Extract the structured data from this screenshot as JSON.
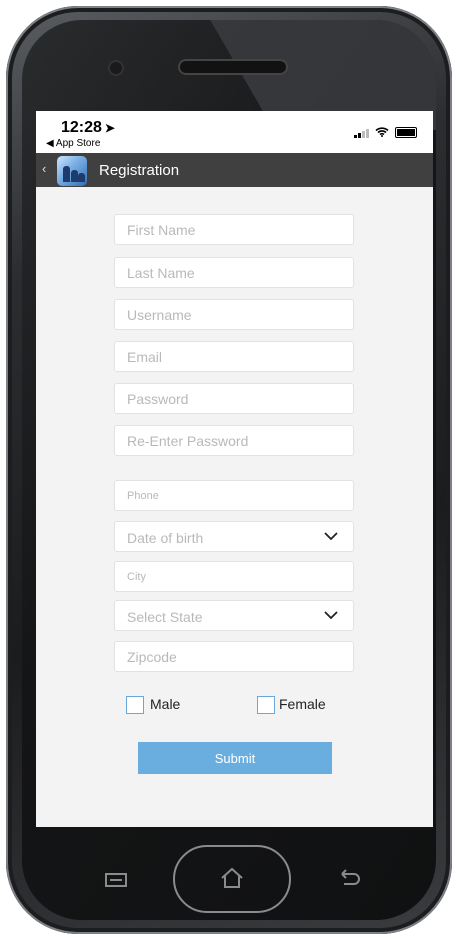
{
  "status": {
    "time": "12:28",
    "back_app": "◀ App Store"
  },
  "nav": {
    "back_glyph": "‹",
    "title": "Registration"
  },
  "form": {
    "first_name": {
      "placeholder": "First Name"
    },
    "last_name": {
      "placeholder": "Last Name"
    },
    "username": {
      "placeholder": "Username"
    },
    "email": {
      "placeholder": "Email"
    },
    "password": {
      "placeholder": "Password"
    },
    "re_password": {
      "placeholder": "Re-Enter Password"
    },
    "phone": {
      "placeholder": "Phone"
    },
    "dob": {
      "value": "Date of birth"
    },
    "city": {
      "placeholder": "City"
    },
    "state": {
      "value": "Select State"
    },
    "zipcode": {
      "placeholder": "Zipcode"
    },
    "gender": {
      "male_label": "Male",
      "female_label": "Female"
    },
    "submit_label": "Submit"
  },
  "colors": {
    "navbar": "#404040",
    "accent": "#6aaee0",
    "screen_bg": "#f3f3f3"
  },
  "icons": {
    "location": "location-arrow-icon",
    "signal": "signal-icon",
    "wifi": "wifi-icon",
    "battery": "battery-icon",
    "chevron": "chevron-down-icon"
  }
}
